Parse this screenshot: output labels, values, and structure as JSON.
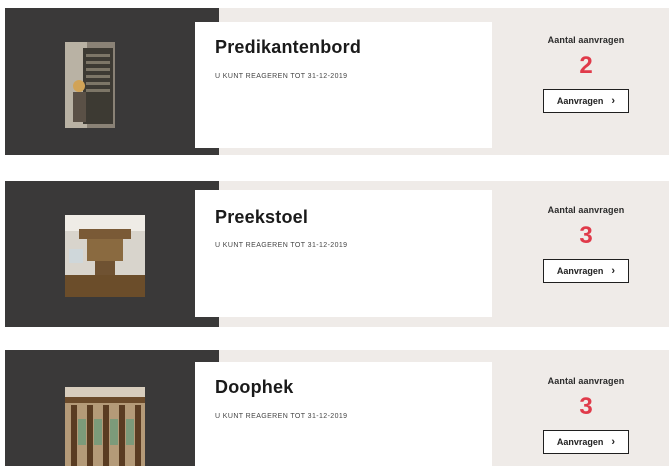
{
  "cards": [
    {
      "title": "Predikantenbord",
      "deadline": "U KUNT REAGEREN TOT 31-12-2019",
      "count_label": "Aantal aanvragen",
      "count": "2",
      "button_label": "Aanvragen",
      "button_icon": "chevron-right-icon"
    },
    {
      "title": "Preekstoel",
      "deadline": "U KUNT REAGEREN TOT 31-12-2019",
      "count_label": "Aantal aanvragen",
      "count": "3",
      "button_label": "Aanvragen",
      "button_icon": "chevron-right-icon"
    },
    {
      "title": "Doophek",
      "deadline": "U KUNT REAGEREN TOT 31-12-2019",
      "count_label": "Aantal aanvragen",
      "count": "3",
      "button_label": "Aanvragen",
      "button_icon": "chevron-right-icon"
    }
  ],
  "colors": {
    "dark_panel": "#3a3939",
    "light_panel": "#efebe8",
    "accent": "#e03a4a"
  }
}
